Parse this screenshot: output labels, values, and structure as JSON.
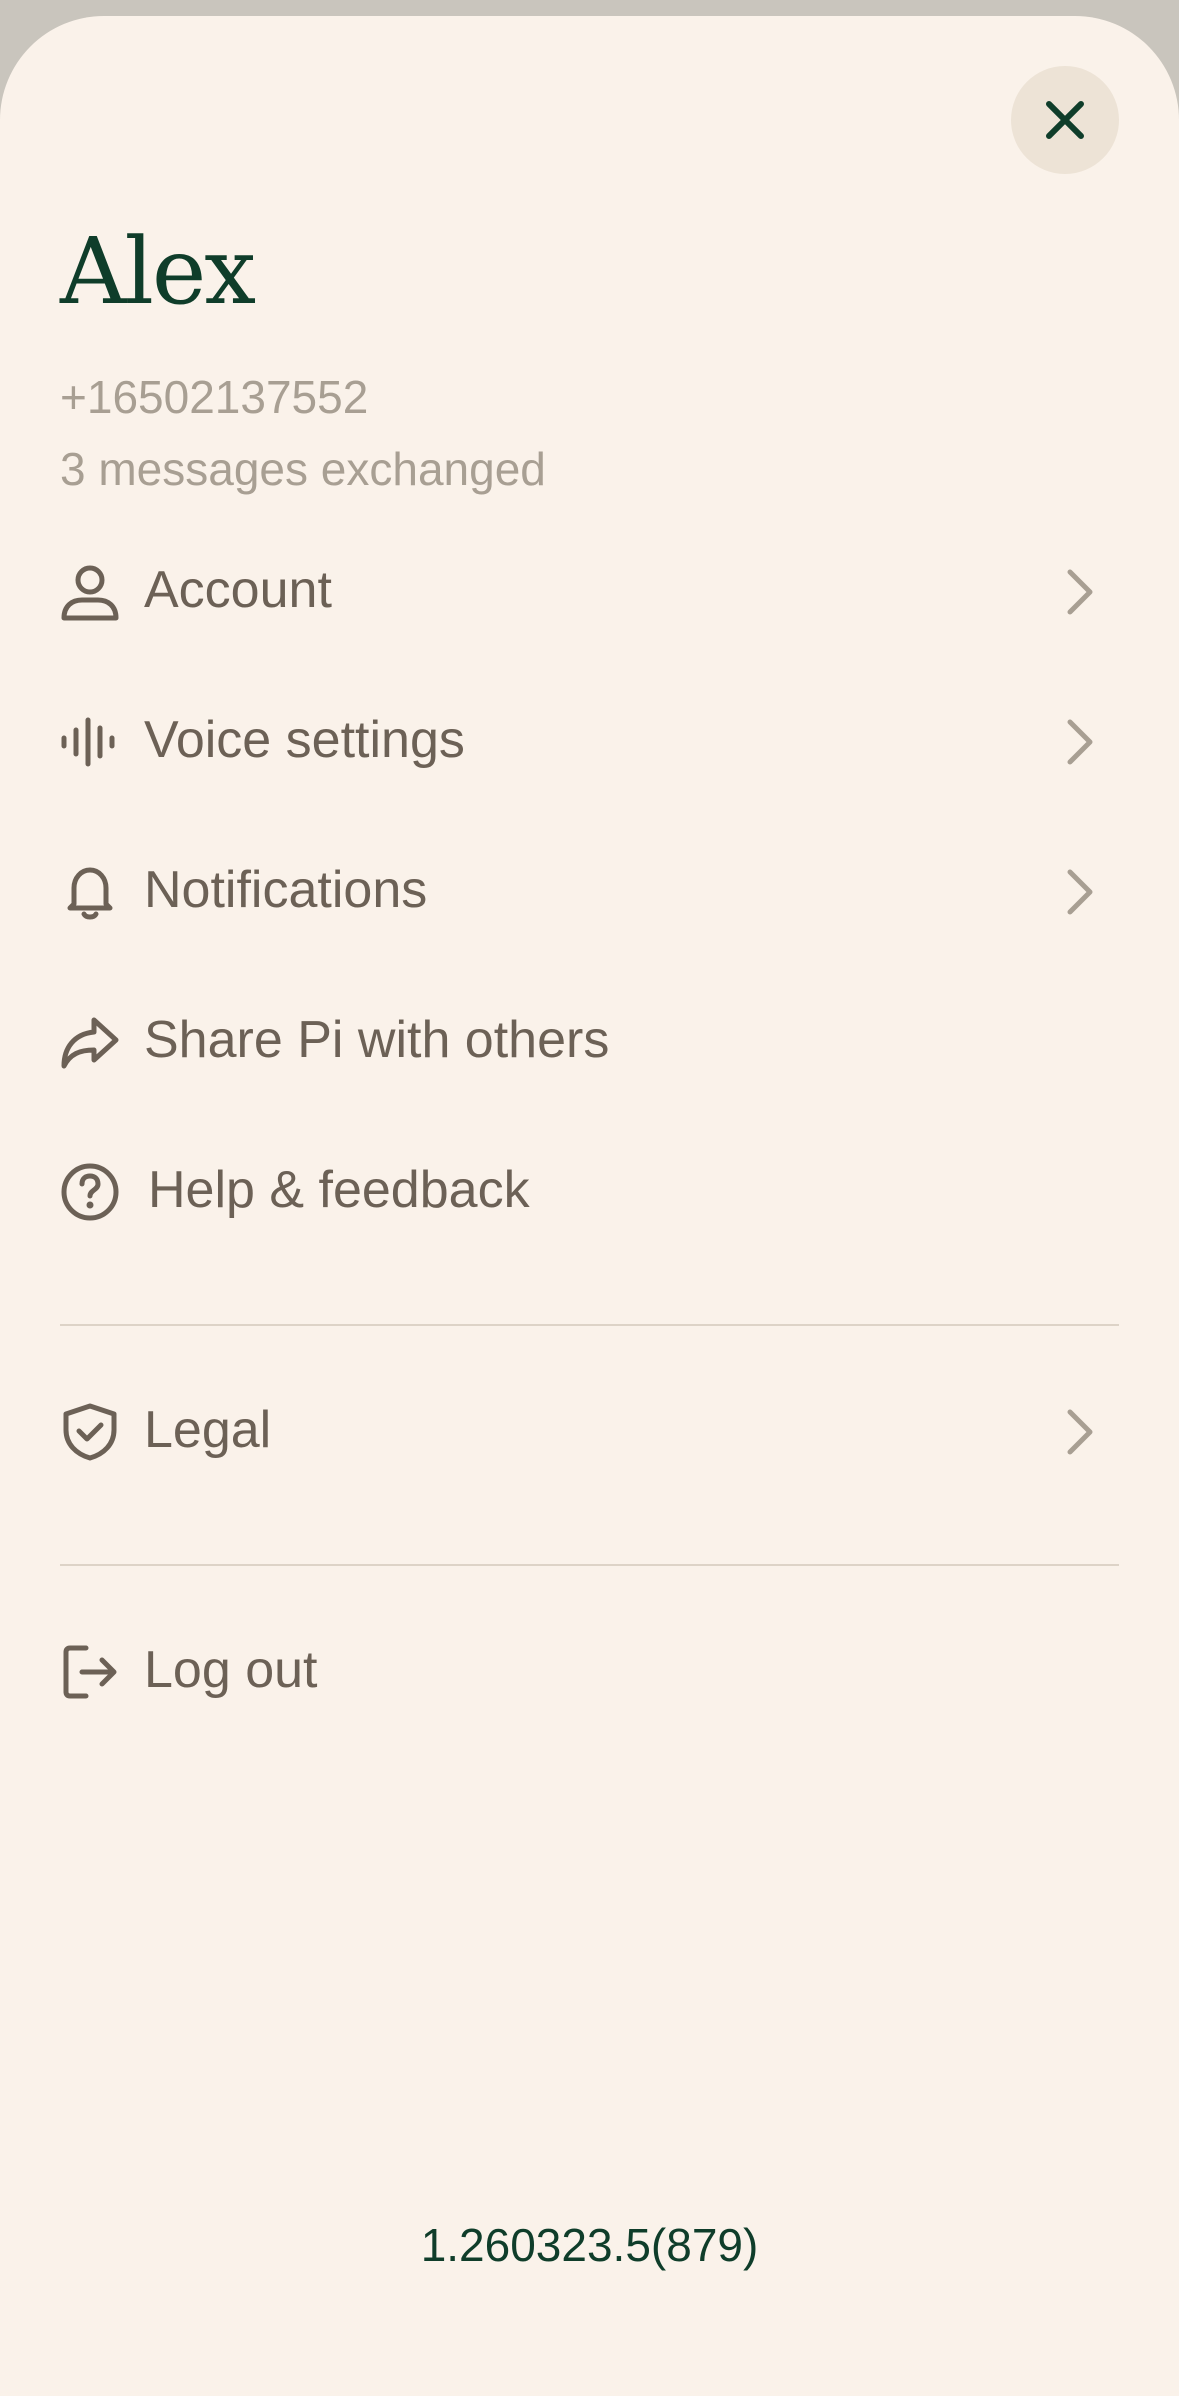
{
  "profile": {
    "name": "Alex",
    "phone": "+16502137552",
    "messages": "3 messages exchanged"
  },
  "menu": {
    "account": "Account",
    "voice": "Voice settings",
    "notifications": "Notifications",
    "share": "Share Pi with others",
    "help": "Help & feedback",
    "legal": "Legal",
    "logout": "Log out"
  },
  "icons": {
    "close": "close-icon",
    "account": "person-icon",
    "voice": "soundwave-icon",
    "notifications": "bell-icon",
    "share": "share-arrow-icon",
    "help": "question-circle-icon",
    "legal": "shield-check-icon",
    "logout": "logout-icon",
    "chevron": "chevron-right-icon"
  },
  "colors": {
    "background": "#faf2ea",
    "accent": "#0f3d2a",
    "text": "#6c6156",
    "muted": "#a89f93",
    "close_button_bg": "#ede3d6"
  },
  "version": "1.260323.5(879)"
}
